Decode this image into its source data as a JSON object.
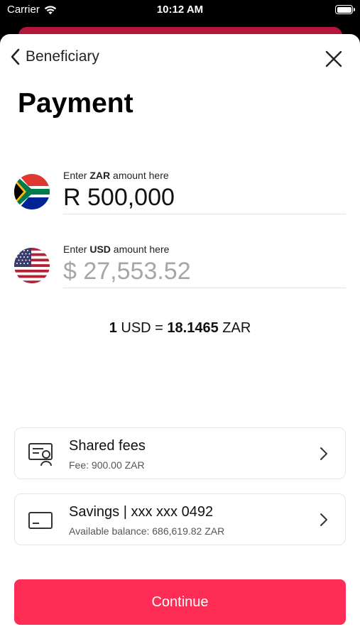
{
  "status_bar": {
    "carrier": "Carrier",
    "time": "10:12 AM"
  },
  "nav": {
    "back_label": "Beneficiary"
  },
  "page": {
    "title": "Payment"
  },
  "source_amount": {
    "label_prefix": "Enter ",
    "currency": "ZAR",
    "label_suffix": " amount here",
    "value": "R 500,000"
  },
  "target_amount": {
    "label_prefix": "Enter ",
    "currency": "USD",
    "label_suffix": " amount here",
    "placeholder": "$ 27,553.52"
  },
  "rate": {
    "from_amount": "1",
    "from_currency": " USD = ",
    "to_amount": "18.1465",
    "to_currency": " ZAR"
  },
  "fees_option": {
    "title": "Shared fees",
    "subtitle": "Fee: 900.00 ZAR"
  },
  "account_option": {
    "title": "Savings | xxx xxx 0492",
    "subtitle": "Available balance:  686,619.82 ZAR"
  },
  "continue_label": "Continue",
  "colors": {
    "accent": "#ff2d55",
    "header_card": "#b3163a"
  }
}
